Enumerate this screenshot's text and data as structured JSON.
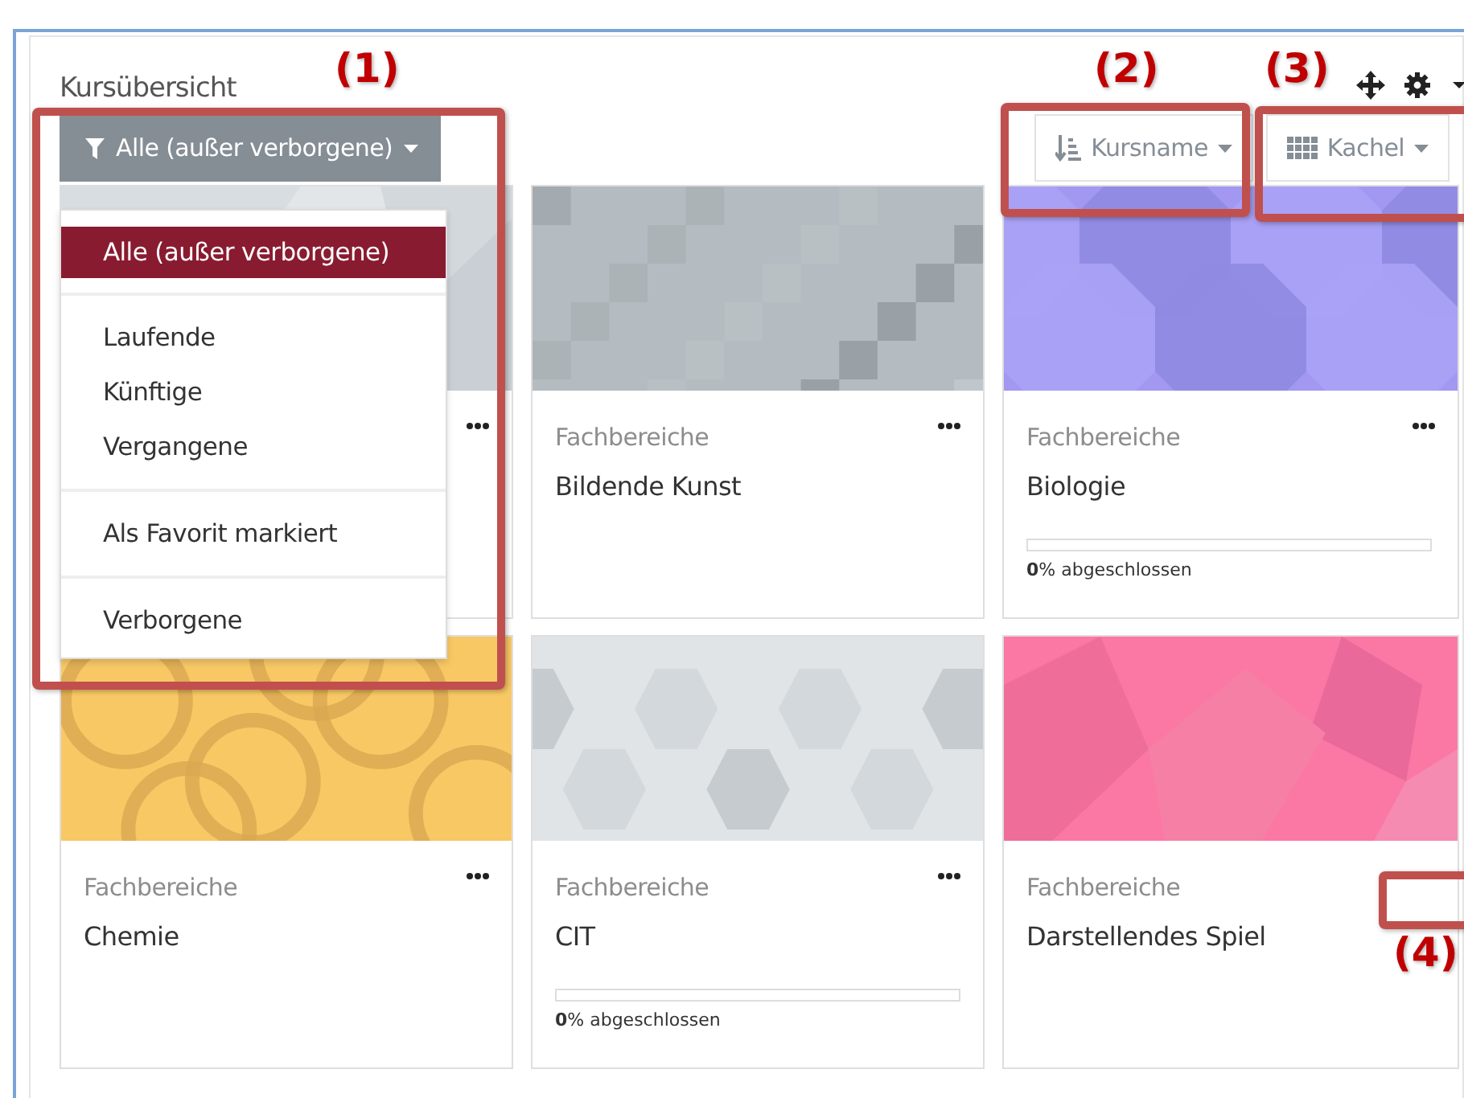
{
  "block": {
    "title": "Kursübersicht"
  },
  "header_controls": [
    {
      "kind": "move"
    },
    {
      "kind": "gear"
    },
    {
      "kind": "caret"
    }
  ],
  "filter_button": {
    "label": "Alle (außer verborgene)"
  },
  "sort_button": {
    "label": "Kursname"
  },
  "view_button": {
    "label": "Kachel"
  },
  "filter_menu": [
    {
      "kind": "item",
      "label": "Alle (außer verborgene)",
      "selected": true
    },
    {
      "kind": "divider"
    },
    {
      "kind": "item",
      "label": "Laufende",
      "selected": false
    },
    {
      "kind": "item",
      "label": "Künftige",
      "selected": false
    },
    {
      "kind": "item",
      "label": "Vergangene",
      "selected": false
    },
    {
      "kind": "divider"
    },
    {
      "kind": "item",
      "label": "Als Favorit markiert",
      "selected": false
    },
    {
      "kind": "divider"
    },
    {
      "kind": "item",
      "label": "Verborgene",
      "selected": false
    }
  ],
  "courses": [
    {
      "image": {
        "kind": "picture"
      }
    },
    {
      "image": {
        "kind": "picture"
      },
      "category": "Fachbereiche",
      "title": "Bildende Kunst"
    },
    {
      "image": {
        "kind": "picture"
      },
      "category": "Fachbereiche",
      "title": "Biologie",
      "progress": {
        "level": 0,
        "text": "**0**% abgeschlossen"
      }
    },
    {
      "image": {
        "kind": "picture"
      },
      "category": "Fachbereiche",
      "title": "Chemie"
    },
    {
      "image": {
        "kind": "picture"
      },
      "category": "Fachbereiche",
      "title": "CIT",
      "progress": {
        "level": 0,
        "text": "**0**% abgeschlossen"
      }
    },
    {
      "image": {
        "kind": "picture"
      },
      "category": "Fachbereiche",
      "title": "Darstellendes Spiel"
    }
  ],
  "annotations": [
    {
      "label": "(1)"
    },
    {
      "label": "(2)"
    },
    {
      "label": "(3)"
    },
    {
      "label": "(4)"
    }
  ]
}
